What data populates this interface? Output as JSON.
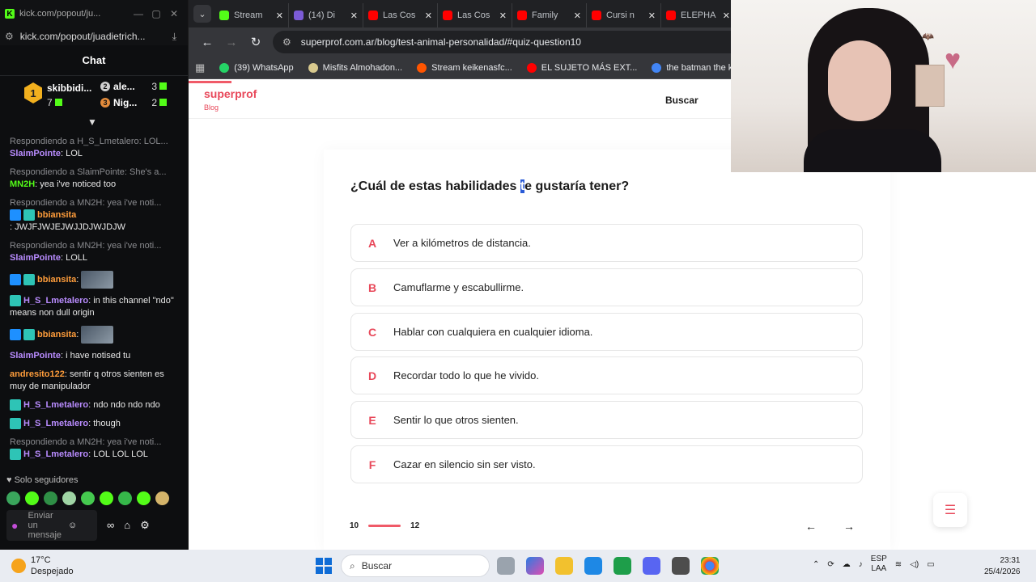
{
  "kick": {
    "window_title": "kick.com/popout/ju...",
    "url": "kick.com/popout/juadietrich...",
    "chat_title": "Chat",
    "leaderboard": {
      "first": {
        "rank": "1",
        "name": "skibbidi...",
        "count": "7"
      },
      "second": {
        "rank": "2",
        "name": "ale...",
        "count": "3"
      },
      "third": {
        "rank": "3",
        "name": "Nig...",
        "count": "2"
      }
    },
    "messages": [
      {
        "reply": "Respondiendo a H_S_Lmetalero: LOL...",
        "user": "SlaimPointe",
        "text": ": LOL",
        "color": "#b98cff"
      },
      {
        "reply": "Respondiendo a SlaimPointe: She's a...",
        "user": "MN2H",
        "text": ": yea i've noticed too",
        "color": "#53fc18"
      },
      {
        "reply": "Respondiendo a MN2H: yea i've noti...",
        "user": "bbiansita",
        "text": ": JWJFJWJEJWJJDJWJDJW",
        "color": "#ff9d3b"
      },
      {
        "reply": "Respondiendo a MN2H: yea i've noti...",
        "user": "SlaimPointe",
        "text": ": LOLL",
        "color": "#b98cff"
      },
      {
        "reply": "",
        "user": "bbiansita",
        "text": ":",
        "color": "#ff9d3b"
      },
      {
        "reply": "",
        "user": "H_S_Lmetalero",
        "text": ": in this channel \"ndo\" means non dull origin",
        "color": "#b98cff"
      },
      {
        "reply": "",
        "user": "bbiansita",
        "text": ":",
        "color": "#ff9d3b"
      },
      {
        "reply": "",
        "user": "SlaimPointe",
        "text": ": i have notised tu",
        "color": "#b98cff"
      },
      {
        "reply": "",
        "user": "andresito122",
        "text": ": sentir q otros sienten es muy de manipulador",
        "color": "#ff9d3b"
      },
      {
        "reply": "",
        "user": "H_S_Lmetalero",
        "text": ": ndo ndo ndo ndo",
        "color": "#b98cff"
      },
      {
        "reply": "",
        "user": "H_S_Lmetalero",
        "text": ": though",
        "color": "#b98cff"
      },
      {
        "reply": "Respondiendo a MN2H: yea i've noti...",
        "user": "H_S_Lmetalero",
        "text": ": LOL LOL LOL",
        "color": "#b98cff"
      }
    ],
    "followers_only": "Solo seguidores",
    "send_placeholder_1": "Enviar",
    "send_placeholder_2": "un",
    "send_placeholder_3": "mensaje"
  },
  "browser": {
    "tabs": [
      {
        "label": "Stream",
        "color": "#53fc18"
      },
      {
        "label": "(14) Di",
        "color": "#7b5bd6"
      },
      {
        "label": "Las Cos",
        "color": "#ff0000"
      },
      {
        "label": "Las Cos",
        "color": "#ff0000"
      },
      {
        "label": "Family",
        "color": "#ff0000"
      },
      {
        "label": "Cursi n",
        "color": "#ff0000"
      },
      {
        "label": "ELEPHA",
        "color": "#ff0000"
      }
    ],
    "url": "superprof.com.ar/blog/test-animal-personalidad/#quiz-question10",
    "bookmarks": [
      {
        "label": "(39) WhatsApp",
        "color": "#25d366"
      },
      {
        "label": "Misfits Almohadon...",
        "color": "#d8c98e"
      },
      {
        "label": "Stream keikenasfc...",
        "color": "#ff5500"
      },
      {
        "label": "EL SUJETO MÁS EXT...",
        "color": "#ff0000"
      },
      {
        "label": "the batman the killi...",
        "color": "#4285f4"
      }
    ]
  },
  "page": {
    "brand": "superprof",
    "brand_sub": "Blog",
    "search_link": "Buscar",
    "question_before": "¿Cuál de estas habilidades ",
    "question_sel": "t",
    "question_after": "e gustaría tener?",
    "options": [
      {
        "letter": "A",
        "text": "Ver a kilómetros de distancia."
      },
      {
        "letter": "B",
        "text": "Camuflarme y escabullirme."
      },
      {
        "letter": "C",
        "text": "Hablar con cualquiera en cualquier idioma."
      },
      {
        "letter": "D",
        "text": "Recordar todo lo que he vivido."
      },
      {
        "letter": "E",
        "text": "Sentir lo que otros sienten."
      },
      {
        "letter": "F",
        "text": "Cazar en silencio sin ser visto."
      }
    ],
    "current_q": "10",
    "total_q": "12",
    "progress_fraction": 0.83
  },
  "taskbar": {
    "temp": "17°C",
    "weather": "Despejado",
    "search": "Buscar",
    "lang1": "ESP",
    "lang2": "LAA",
    "time": "23:31",
    "date": "25/4/2026"
  }
}
